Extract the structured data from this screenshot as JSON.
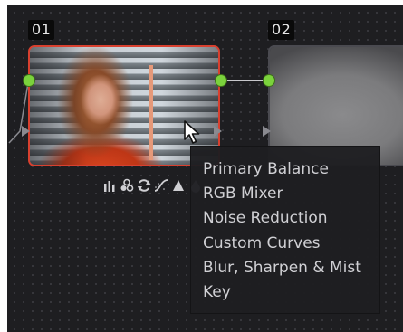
{
  "colors": {
    "canvas_bg": "#1e1e21",
    "selected_border": "#d8402f",
    "port_green": "#7bd23c",
    "tooltip_bg": "#1e1e21",
    "tooltip_text": "#d0d0d4"
  },
  "nodes": [
    {
      "number": "01",
      "selected": true,
      "thumbnail": "woman-on-phone-red-jacket"
    },
    {
      "number": "02",
      "selected": false,
      "thumbnail": "blurred-grey-frame"
    }
  ],
  "node_tool_icons": [
    "primary-balance-icon",
    "rgb-mixer-icon",
    "noise-reduction-icon",
    "custom-curves-icon",
    "blur-sharpen-mist-icon",
    "key-icon"
  ],
  "tooltip": {
    "items": [
      "Primary Balance",
      "RGB Mixer",
      "Noise Reduction",
      "Custom Curves",
      "Blur, Sharpen & Mist",
      "Key"
    ]
  }
}
